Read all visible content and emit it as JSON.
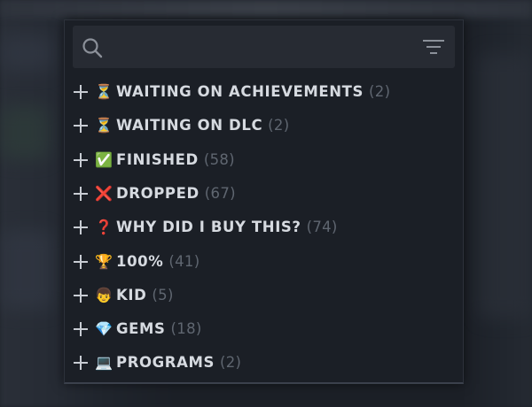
{
  "search": {
    "icon": "search-icon",
    "filter_icon": "filter-lines-icon"
  },
  "categories": [
    {
      "emoji": "⏳",
      "icon": "hourglass-icon",
      "name": "WAITING ON ACHIEVEMENTS",
      "count": "(2)"
    },
    {
      "emoji": "⏳",
      "icon": "hourglass-icon",
      "name": "WAITING ON DLC",
      "count": "(2)"
    },
    {
      "emoji": "✅",
      "icon": "check-box-icon",
      "name": "FINISHED",
      "count": "(58)"
    },
    {
      "emoji": "❌",
      "icon": "cross-mark-icon",
      "name": "DROPPED",
      "count": "(67)"
    },
    {
      "emoji": "❓",
      "icon": "question-mark-icon",
      "name": "WHY DID I BUY THIS?",
      "count": "(74)"
    },
    {
      "emoji": "🏆",
      "icon": "trophy-icon",
      "name": "100%",
      "count": "(41)"
    },
    {
      "emoji": "👦",
      "icon": "kid-face-icon",
      "name": "KID",
      "count": "(5)"
    },
    {
      "emoji": "💎",
      "icon": "gem-icon",
      "name": "GEMS",
      "count": "(18)"
    },
    {
      "emoji": "💻",
      "icon": "laptop-icon",
      "name": "PROGRAMS",
      "count": "(2)"
    }
  ],
  "colors": {
    "panel_bg": "#1b1f26",
    "search_bg": "#272b33",
    "label": "#d6dae0",
    "count": "#5f6670",
    "plus": "#c8ccd3"
  }
}
